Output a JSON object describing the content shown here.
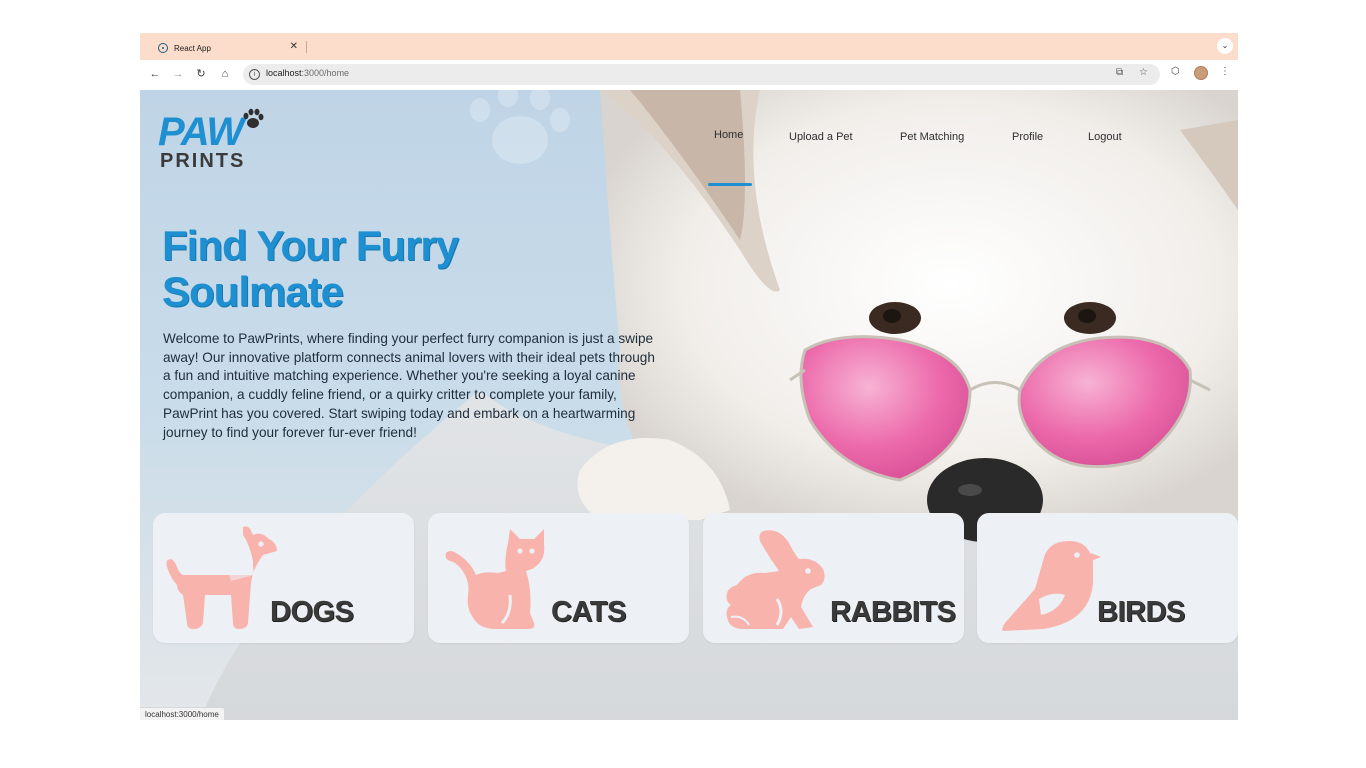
{
  "browser": {
    "tab": {
      "title": "React App",
      "close": "✕"
    },
    "address": {
      "host": "localhost",
      "path": ":3000/home"
    },
    "status_url": "localhost:3000/home"
  },
  "logo": {
    "top": "PAW",
    "bottom": "PRINTS"
  },
  "nav": {
    "items": [
      {
        "label": "Home",
        "active": true
      },
      {
        "label": "Upload a Pet"
      },
      {
        "label": "Pet Matching"
      },
      {
        "label": "Profile"
      },
      {
        "label": "Logout"
      }
    ]
  },
  "hero": {
    "headline_line1": "Find Your Furry",
    "headline_line2": "Soulmate",
    "intro": "Welcome to PawPrints, where finding your perfect furry companion is just a swipe away! Our innovative platform connects animal lovers with their ideal pets through a fun and intuitive matching experience. Whether you're seeking a loyal canine companion, a cuddly feline friend, or a quirky critter to complete your family, PawPrint has you covered. Start swiping today and embark on a heartwarming journey to find your forever fur-ever friend!"
  },
  "categories": [
    {
      "label": "DOGS",
      "icon": "dog-icon"
    },
    {
      "label": "CATS",
      "icon": "cat-icon"
    },
    {
      "label": "RABBITS",
      "icon": "rabbit-icon"
    },
    {
      "label": "BIRDS",
      "icon": "bird-icon"
    }
  ],
  "colors": {
    "brand_blue": "#1e8fd0",
    "icon_pink": "#f9b3ad",
    "tabbar": "#fcdccb",
    "card_bg": "#edf1f5"
  }
}
